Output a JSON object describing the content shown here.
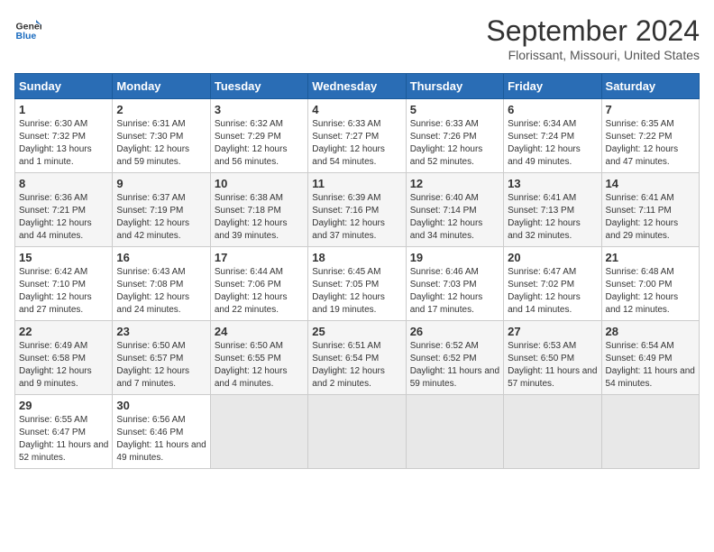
{
  "header": {
    "logo_line1": "General",
    "logo_line2": "Blue",
    "month": "September 2024",
    "location": "Florissant, Missouri, United States"
  },
  "weekdays": [
    "Sunday",
    "Monday",
    "Tuesday",
    "Wednesday",
    "Thursday",
    "Friday",
    "Saturday"
  ],
  "weeks": [
    [
      {
        "day": "1",
        "sunrise": "6:30 AM",
        "sunset": "7:32 PM",
        "daylight": "13 hours and 1 minute."
      },
      {
        "day": "2",
        "sunrise": "6:31 AM",
        "sunset": "7:30 PM",
        "daylight": "12 hours and 59 minutes."
      },
      {
        "day": "3",
        "sunrise": "6:32 AM",
        "sunset": "7:29 PM",
        "daylight": "12 hours and 56 minutes."
      },
      {
        "day": "4",
        "sunrise": "6:33 AM",
        "sunset": "7:27 PM",
        "daylight": "12 hours and 54 minutes."
      },
      {
        "day": "5",
        "sunrise": "6:33 AM",
        "sunset": "7:26 PM",
        "daylight": "12 hours and 52 minutes."
      },
      {
        "day": "6",
        "sunrise": "6:34 AM",
        "sunset": "7:24 PM",
        "daylight": "12 hours and 49 minutes."
      },
      {
        "day": "7",
        "sunrise": "6:35 AM",
        "sunset": "7:22 PM",
        "daylight": "12 hours and 47 minutes."
      }
    ],
    [
      {
        "day": "8",
        "sunrise": "6:36 AM",
        "sunset": "7:21 PM",
        "daylight": "12 hours and 44 minutes."
      },
      {
        "day": "9",
        "sunrise": "6:37 AM",
        "sunset": "7:19 PM",
        "daylight": "12 hours and 42 minutes."
      },
      {
        "day": "10",
        "sunrise": "6:38 AM",
        "sunset": "7:18 PM",
        "daylight": "12 hours and 39 minutes."
      },
      {
        "day": "11",
        "sunrise": "6:39 AM",
        "sunset": "7:16 PM",
        "daylight": "12 hours and 37 minutes."
      },
      {
        "day": "12",
        "sunrise": "6:40 AM",
        "sunset": "7:14 PM",
        "daylight": "12 hours and 34 minutes."
      },
      {
        "day": "13",
        "sunrise": "6:41 AM",
        "sunset": "7:13 PM",
        "daylight": "12 hours and 32 minutes."
      },
      {
        "day": "14",
        "sunrise": "6:41 AM",
        "sunset": "7:11 PM",
        "daylight": "12 hours and 29 minutes."
      }
    ],
    [
      {
        "day": "15",
        "sunrise": "6:42 AM",
        "sunset": "7:10 PM",
        "daylight": "12 hours and 27 minutes."
      },
      {
        "day": "16",
        "sunrise": "6:43 AM",
        "sunset": "7:08 PM",
        "daylight": "12 hours and 24 minutes."
      },
      {
        "day": "17",
        "sunrise": "6:44 AM",
        "sunset": "7:06 PM",
        "daylight": "12 hours and 22 minutes."
      },
      {
        "day": "18",
        "sunrise": "6:45 AM",
        "sunset": "7:05 PM",
        "daylight": "12 hours and 19 minutes."
      },
      {
        "day": "19",
        "sunrise": "6:46 AM",
        "sunset": "7:03 PM",
        "daylight": "12 hours and 17 minutes."
      },
      {
        "day": "20",
        "sunrise": "6:47 AM",
        "sunset": "7:02 PM",
        "daylight": "12 hours and 14 minutes."
      },
      {
        "day": "21",
        "sunrise": "6:48 AM",
        "sunset": "7:00 PM",
        "daylight": "12 hours and 12 minutes."
      }
    ],
    [
      {
        "day": "22",
        "sunrise": "6:49 AM",
        "sunset": "6:58 PM",
        "daylight": "12 hours and 9 minutes."
      },
      {
        "day": "23",
        "sunrise": "6:50 AM",
        "sunset": "6:57 PM",
        "daylight": "12 hours and 7 minutes."
      },
      {
        "day": "24",
        "sunrise": "6:50 AM",
        "sunset": "6:55 PM",
        "daylight": "12 hours and 4 minutes."
      },
      {
        "day": "25",
        "sunrise": "6:51 AM",
        "sunset": "6:54 PM",
        "daylight": "12 hours and 2 minutes."
      },
      {
        "day": "26",
        "sunrise": "6:52 AM",
        "sunset": "6:52 PM",
        "daylight": "11 hours and 59 minutes."
      },
      {
        "day": "27",
        "sunrise": "6:53 AM",
        "sunset": "6:50 PM",
        "daylight": "11 hours and 57 minutes."
      },
      {
        "day": "28",
        "sunrise": "6:54 AM",
        "sunset": "6:49 PM",
        "daylight": "11 hours and 54 minutes."
      }
    ],
    [
      {
        "day": "29",
        "sunrise": "6:55 AM",
        "sunset": "6:47 PM",
        "daylight": "11 hours and 52 minutes."
      },
      {
        "day": "30",
        "sunrise": "6:56 AM",
        "sunset": "6:46 PM",
        "daylight": "11 hours and 49 minutes."
      },
      null,
      null,
      null,
      null,
      null
    ]
  ]
}
